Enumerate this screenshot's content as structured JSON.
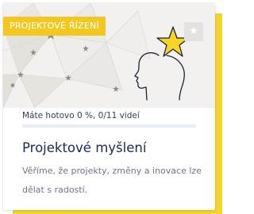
{
  "card": {
    "category": "PROJEKTOVÉ ŘÍZENÍ",
    "favorite_icon": "star-icon",
    "illustration_icon": "head-with-star-icon",
    "progress_text": "Máte hotovo 0 %, 0/11 videí",
    "progress_fraction": 0,
    "title": "Projektové myšlení",
    "description": "Věříme, že projekty, změny a inovace lze dělat s radostí."
  },
  "colors": {
    "accent": "#f2c71f",
    "title": "#1d2a52",
    "text": "#6f7489",
    "track": "#e6edf5"
  }
}
